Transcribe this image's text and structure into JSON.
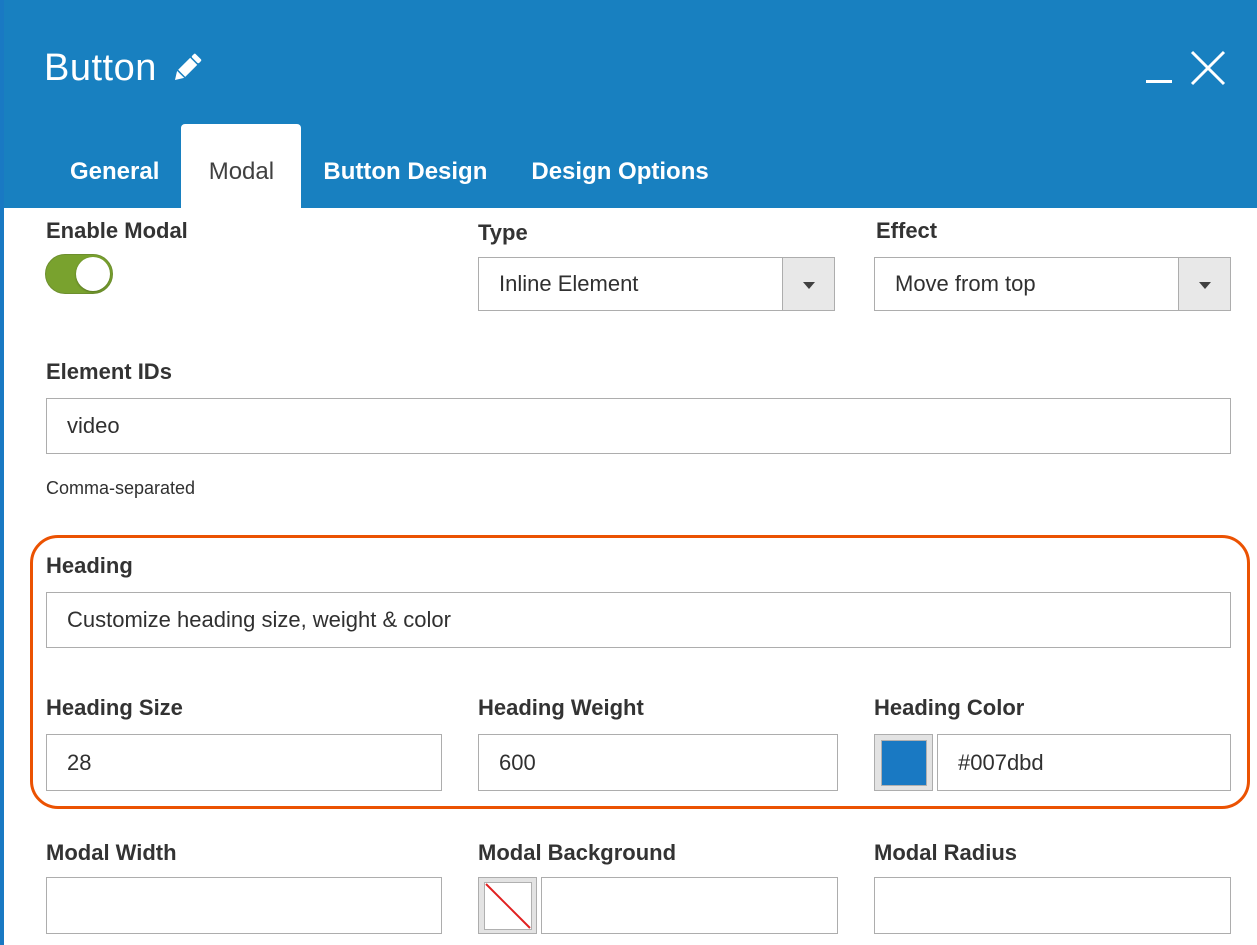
{
  "header": {
    "title": "Button",
    "icons": {
      "edit": "pencil-icon",
      "minimize": "minimize-icon",
      "close": "close-icon"
    },
    "colors": {
      "background": "#1880c0"
    }
  },
  "tabs": [
    {
      "label": "General"
    },
    {
      "label": "Modal",
      "active": true
    },
    {
      "label": "Button Design"
    },
    {
      "label": "Design Options"
    }
  ],
  "form": {
    "enable_modal": {
      "label": "Enable Modal",
      "on": true
    },
    "type": {
      "label": "Type",
      "value": "Inline Element"
    },
    "effect": {
      "label": "Effect",
      "value": "Move from top"
    },
    "element_ids": {
      "label": "Element IDs",
      "value": "video",
      "note": "Comma-separated"
    },
    "heading": {
      "label": "Heading",
      "value": "Customize heading size, weight & color"
    },
    "heading_size": {
      "label": "Heading Size",
      "value": "28"
    },
    "heading_weight": {
      "label": "Heading Weight",
      "value": "600"
    },
    "heading_color": {
      "label": "Heading Color",
      "value": "#007dbd",
      "swatch": "#1979c3"
    },
    "modal_width": {
      "label": "Modal Width",
      "value": ""
    },
    "modal_background": {
      "label": "Modal Background",
      "value": ""
    },
    "modal_radius": {
      "label": "Modal Radius",
      "value": ""
    }
  },
  "colors": {
    "highlight": "#eb5202",
    "toggle_on": "#79a22e"
  }
}
